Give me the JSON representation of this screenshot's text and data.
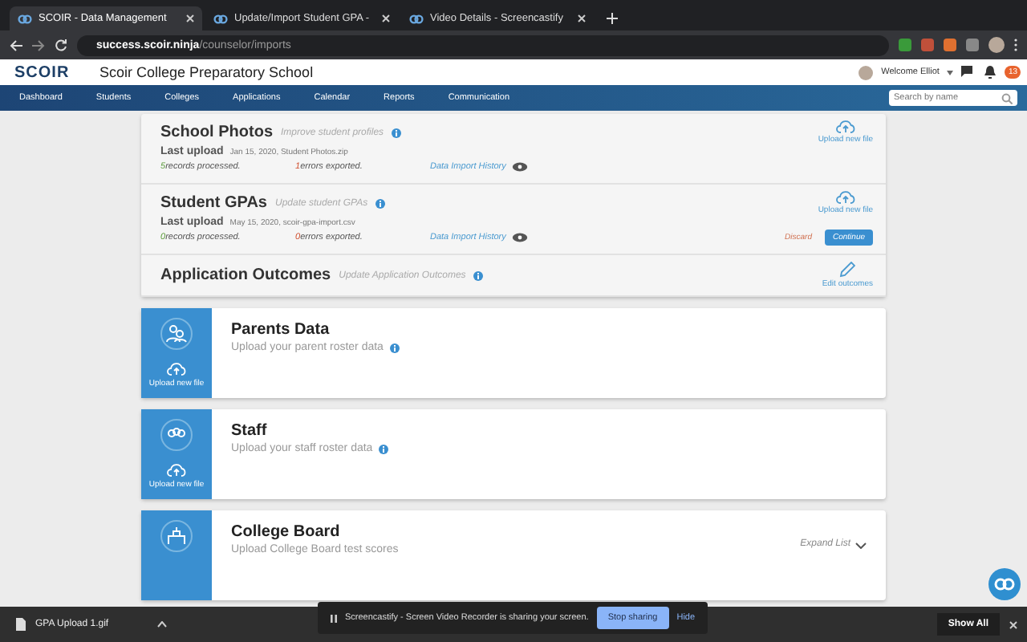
{
  "browser": {
    "tabs": [
      {
        "title": "SCOIR - Data Management",
        "selected": true
      },
      {
        "title": "Update/Import Student GPA -",
        "selected": false
      },
      {
        "title": "Video Details - Screencastify",
        "selected": false
      }
    ],
    "url": {
      "host": "success.scoir.ninja",
      "path": "/counselor/imports"
    }
  },
  "header": {
    "logo": "SCOIR",
    "school": "Scoir College Preparatory School",
    "user": "Welcome Elliot",
    "notification_count": "13"
  },
  "nav": {
    "items": [
      "Dashboard",
      "Students",
      "Colleges",
      "Applications",
      "Calendar",
      "Reports",
      "Communication"
    ],
    "search_placeholder": "Search by name"
  },
  "imports": [
    {
      "title": "School Photos",
      "subtitle": "Improve student profiles",
      "kind": "upload",
      "action": "Upload new file",
      "last_upload_label": "Last upload",
      "last_upload": "Jan 15, 2020, Student Photos.zip",
      "processed_count": "5",
      "processed_label": "records processed.",
      "errors_count": "1",
      "errors_label": "errors exported.",
      "history": "Data Import History"
    },
    {
      "title": "Student GPAs",
      "subtitle": "Update student GPAs",
      "kind": "upload",
      "action": "Upload new file",
      "last_upload_label": "Last upload",
      "last_upload": "May 15, 2020, scoir-gpa-import.csv",
      "processed_count": "0",
      "processed_label": "records processed.",
      "errors_count": "0",
      "errors_label": "errors exported.",
      "history": "Data Import History",
      "discard": "Discard",
      "continue": "Continue"
    },
    {
      "title": "Application Outcomes",
      "subtitle": "Update Application Outcomes",
      "kind": "edit",
      "action": "Edit outcomes"
    }
  ],
  "data_cards": [
    {
      "kind": "parents",
      "title": "Parents Data",
      "subtitle": "Upload your parent roster data",
      "info": true,
      "upload": "Upload new file"
    },
    {
      "kind": "staff",
      "title": "Staff",
      "subtitle": "Upload your staff roster data",
      "info": true,
      "upload": "Upload new file"
    },
    {
      "kind": "college",
      "title": "College Board",
      "subtitle": "Upload College Board test scores",
      "info": false,
      "expand": "Expand List"
    }
  ],
  "sharing_bar": {
    "message": "Screencastify - Screen Video Recorder is sharing your screen.",
    "stop": "Stop sharing",
    "hide": "Hide"
  },
  "download_bar": {
    "file": "GPA Upload 1.gif",
    "show_all": "Show All"
  }
}
